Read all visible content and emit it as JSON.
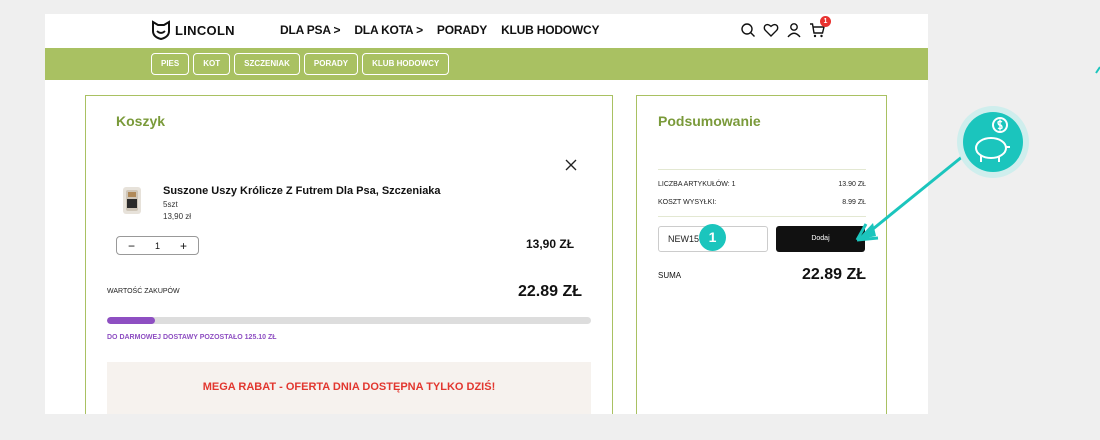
{
  "brand": {
    "name": "LINCOLN"
  },
  "main_nav": [
    "DLA PSA",
    "DLA KOTA",
    "PORADY",
    "KLUB HODOWCY"
  ],
  "main_nav_arrows": [
    ">",
    ">",
    "",
    ""
  ],
  "sub_nav": [
    "PIES",
    "KOT",
    "SZCZENIAK",
    "PORADY",
    "KLUB HODOWCY"
  ],
  "header": {
    "cart_count": "1"
  },
  "cart": {
    "title": "Koszyk",
    "item": {
      "name": "Suszone Uszy Królicze Z Futrem Dla Psa, Szczeniaka",
      "pack": "5szt",
      "unit_price": "13,90 zł",
      "quantity": "1",
      "minus": "−",
      "plus": "+",
      "line_total": "13,90 ZŁ"
    },
    "purchase_value_label": "WARTOŚĆ ZAKUPÓW",
    "purchase_value": "22.89 ZŁ",
    "free_shipping_progress": 0.1,
    "free_shipping_note": "DO DARMOWEJ DOSTAWY POZOSTAŁO 125.10 ZŁ",
    "promo_text": "MEGA RABAT - OFERTA DNIA DOSTĘPNA TYLKO DZIŚ!"
  },
  "summary": {
    "title": "Podsumowanie",
    "items_label": "LICZBA ARTYKUŁÓW: 1",
    "items_value": "13.90 ZŁ",
    "shipping_label": "KOSZT WYSYŁKI:",
    "shipping_value": "8.99 ZŁ",
    "coupon_value": "NEW15",
    "coupon_button": "Dodaj",
    "total_label": "SUMA",
    "total_value": "22.89 ZŁ"
  },
  "annotation": {
    "step_number": "1",
    "accent": "#1bc5bd"
  },
  "colors": {
    "green": "#a9c162",
    "title_green": "#7a9a3a",
    "purple": "#8e4fc2",
    "red": "#e2372f"
  }
}
